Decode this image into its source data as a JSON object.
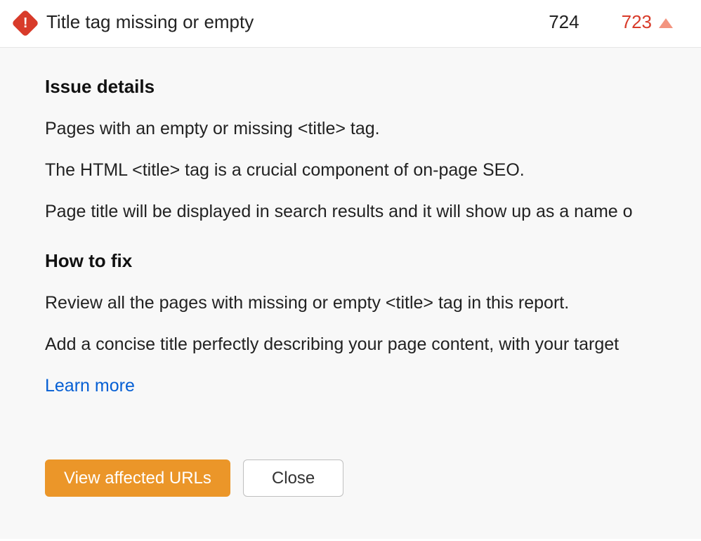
{
  "row": {
    "title": "Title tag missing or empty",
    "pages": "724",
    "added": "723"
  },
  "details": {
    "heading": "Issue details",
    "p1": "Pages with an empty or missing <title> tag.",
    "p2": "The HTML <title> tag is a crucial component of on-page SEO.",
    "p3": "Page title will be displayed in search results and it will show up as a name o"
  },
  "fix": {
    "heading": "How to fix",
    "p1": "Review all the pages with missing or empty <title> tag in this report.",
    "p2": "Add a concise title perfectly describing your page content, with your target",
    "learn": "Learn more"
  },
  "buttons": {
    "view": "View affected URLs",
    "close": "Close"
  }
}
